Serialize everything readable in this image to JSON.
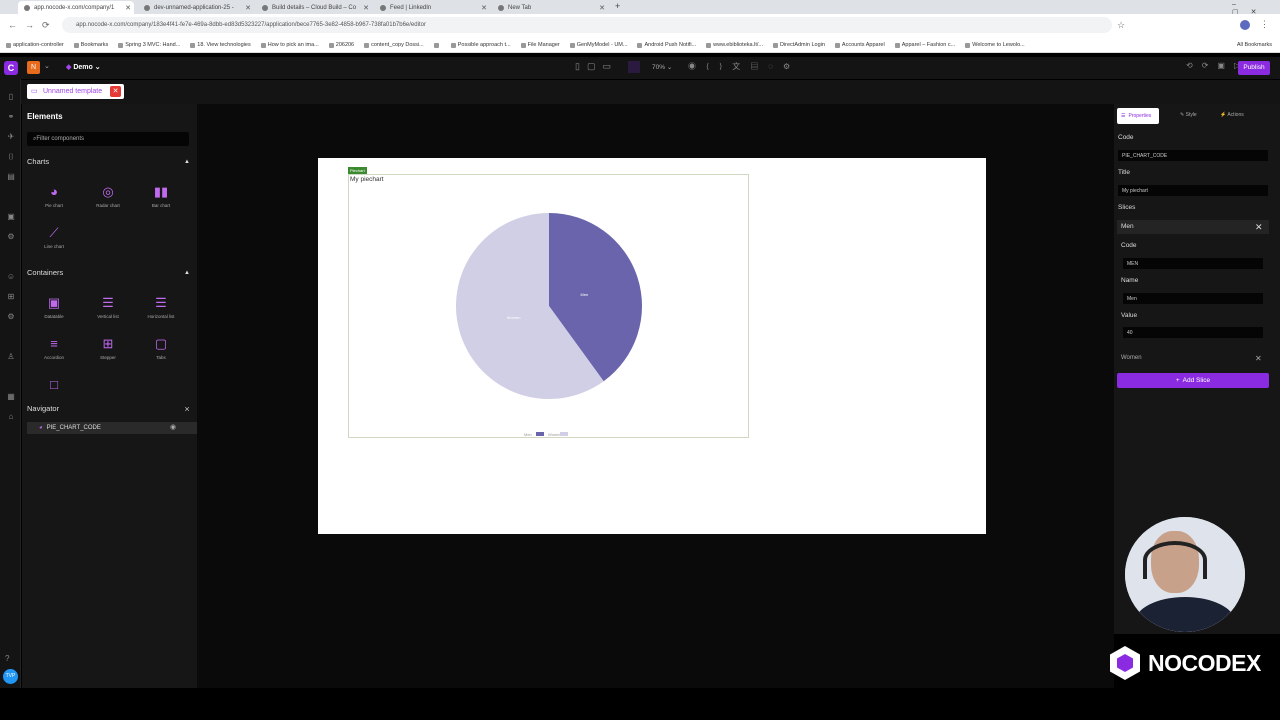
{
  "browser": {
    "tabs": [
      {
        "title": "app.nocode-x.com/company/1",
        "active": true
      },
      {
        "title": "dev-unnamed-application-25 -",
        "active": false
      },
      {
        "title": "Build details – Cloud Build – Co",
        "active": false
      },
      {
        "title": "Feed | LinkedIn",
        "active": false
      },
      {
        "title": "New Tab",
        "active": false
      }
    ],
    "url": "app.nocode-x.com/company/183e4f41-fe7e-469a-8dbb-ed83d5323227/application/bece7765-3e82-4858-b967-738fa01b7b6e/editor",
    "bookmarks": [
      "application-controller",
      "Bookmarks",
      "Spring 3 MVC: Hand...",
      "18. View technologies",
      "How to pick an ima...",
      "206206",
      "content_copy Dossi...",
      "",
      "Possible approach t...",
      "File Manager",
      "GenMyModel - UM...",
      "Android Push Notifi...",
      "www.ebiblioteka.lt/...",
      "DirectAdmin Login",
      "Accounts Apparel",
      "Apparel – Fashion c...",
      "Welcome to Lewolo..."
    ],
    "all_bookmarks": "All Bookmarks"
  },
  "app": {
    "workspace_badge": "N",
    "project": "Demo",
    "zoom": "70%",
    "publish": "Publish",
    "template_tab": "Unnamed template"
  },
  "elements": {
    "title": "Elements",
    "filter_placeholder": "Filter components",
    "charts_title": "Charts",
    "charts": [
      "Pie chart",
      "Radar chart",
      "Bar chart",
      "Line chart"
    ],
    "containers_title": "Containers",
    "containers": [
      "Datatable",
      "Vertical list",
      "Horizontal list",
      "Accordion",
      "Stepper",
      "Tabs",
      ""
    ]
  },
  "navigator": {
    "title": "Navigator",
    "item": "PIE_CHART_CODE"
  },
  "canvas": {
    "tag": "Piechart",
    "title": "My piechart"
  },
  "chart_data": {
    "type": "pie",
    "title": "My piechart",
    "slices": [
      {
        "name": "Men",
        "value": 40,
        "color": "#6a64ac"
      },
      {
        "name": "Women",
        "value": 60,
        "color": "#d0cfe5"
      }
    ],
    "data_labels": [
      "Men",
      "Women"
    ],
    "legend": "bottom-center",
    "legend_labels": [
      "Men",
      "Women"
    ]
  },
  "properties": {
    "tabs": [
      "Properties",
      "Style",
      "Actions"
    ],
    "code_label": "Code",
    "code_value": "PIE_CHART_CODE",
    "title_label": "Title",
    "title_value": "My piechart",
    "slices_label": "Slices",
    "slice_open": {
      "header": "Men",
      "code_label": "Code",
      "code_value": "MEN",
      "name_label": "Name",
      "name_value": "Men",
      "value_label": "Value",
      "value_value": "40"
    },
    "slice_collapsed": "Women",
    "add_slice": "Add Slice"
  },
  "brand": {
    "logo_text": "NOCODEX"
  },
  "rail_user": "TVP",
  "colors": {
    "accent": "#8a2be2",
    "pie_dark": "#6a64ac",
    "pie_light": "#d0cfe5"
  }
}
